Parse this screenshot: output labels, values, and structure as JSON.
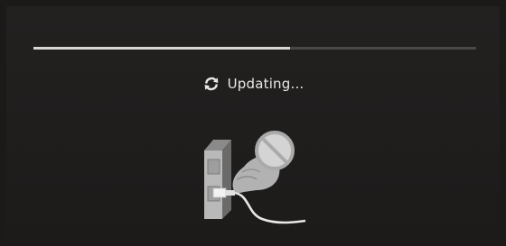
{
  "update": {
    "status_text": "Updating...",
    "progress_fraction": 0.58
  },
  "icons": {
    "status": "refresh-icon",
    "warning": "do-not-unplug-icon"
  },
  "colors": {
    "background": "#1c1a19",
    "screen": "#211f1e",
    "progress_fill": "#d6d6d6",
    "progress_track": "#4a4846",
    "text": "#e8e8e8"
  }
}
